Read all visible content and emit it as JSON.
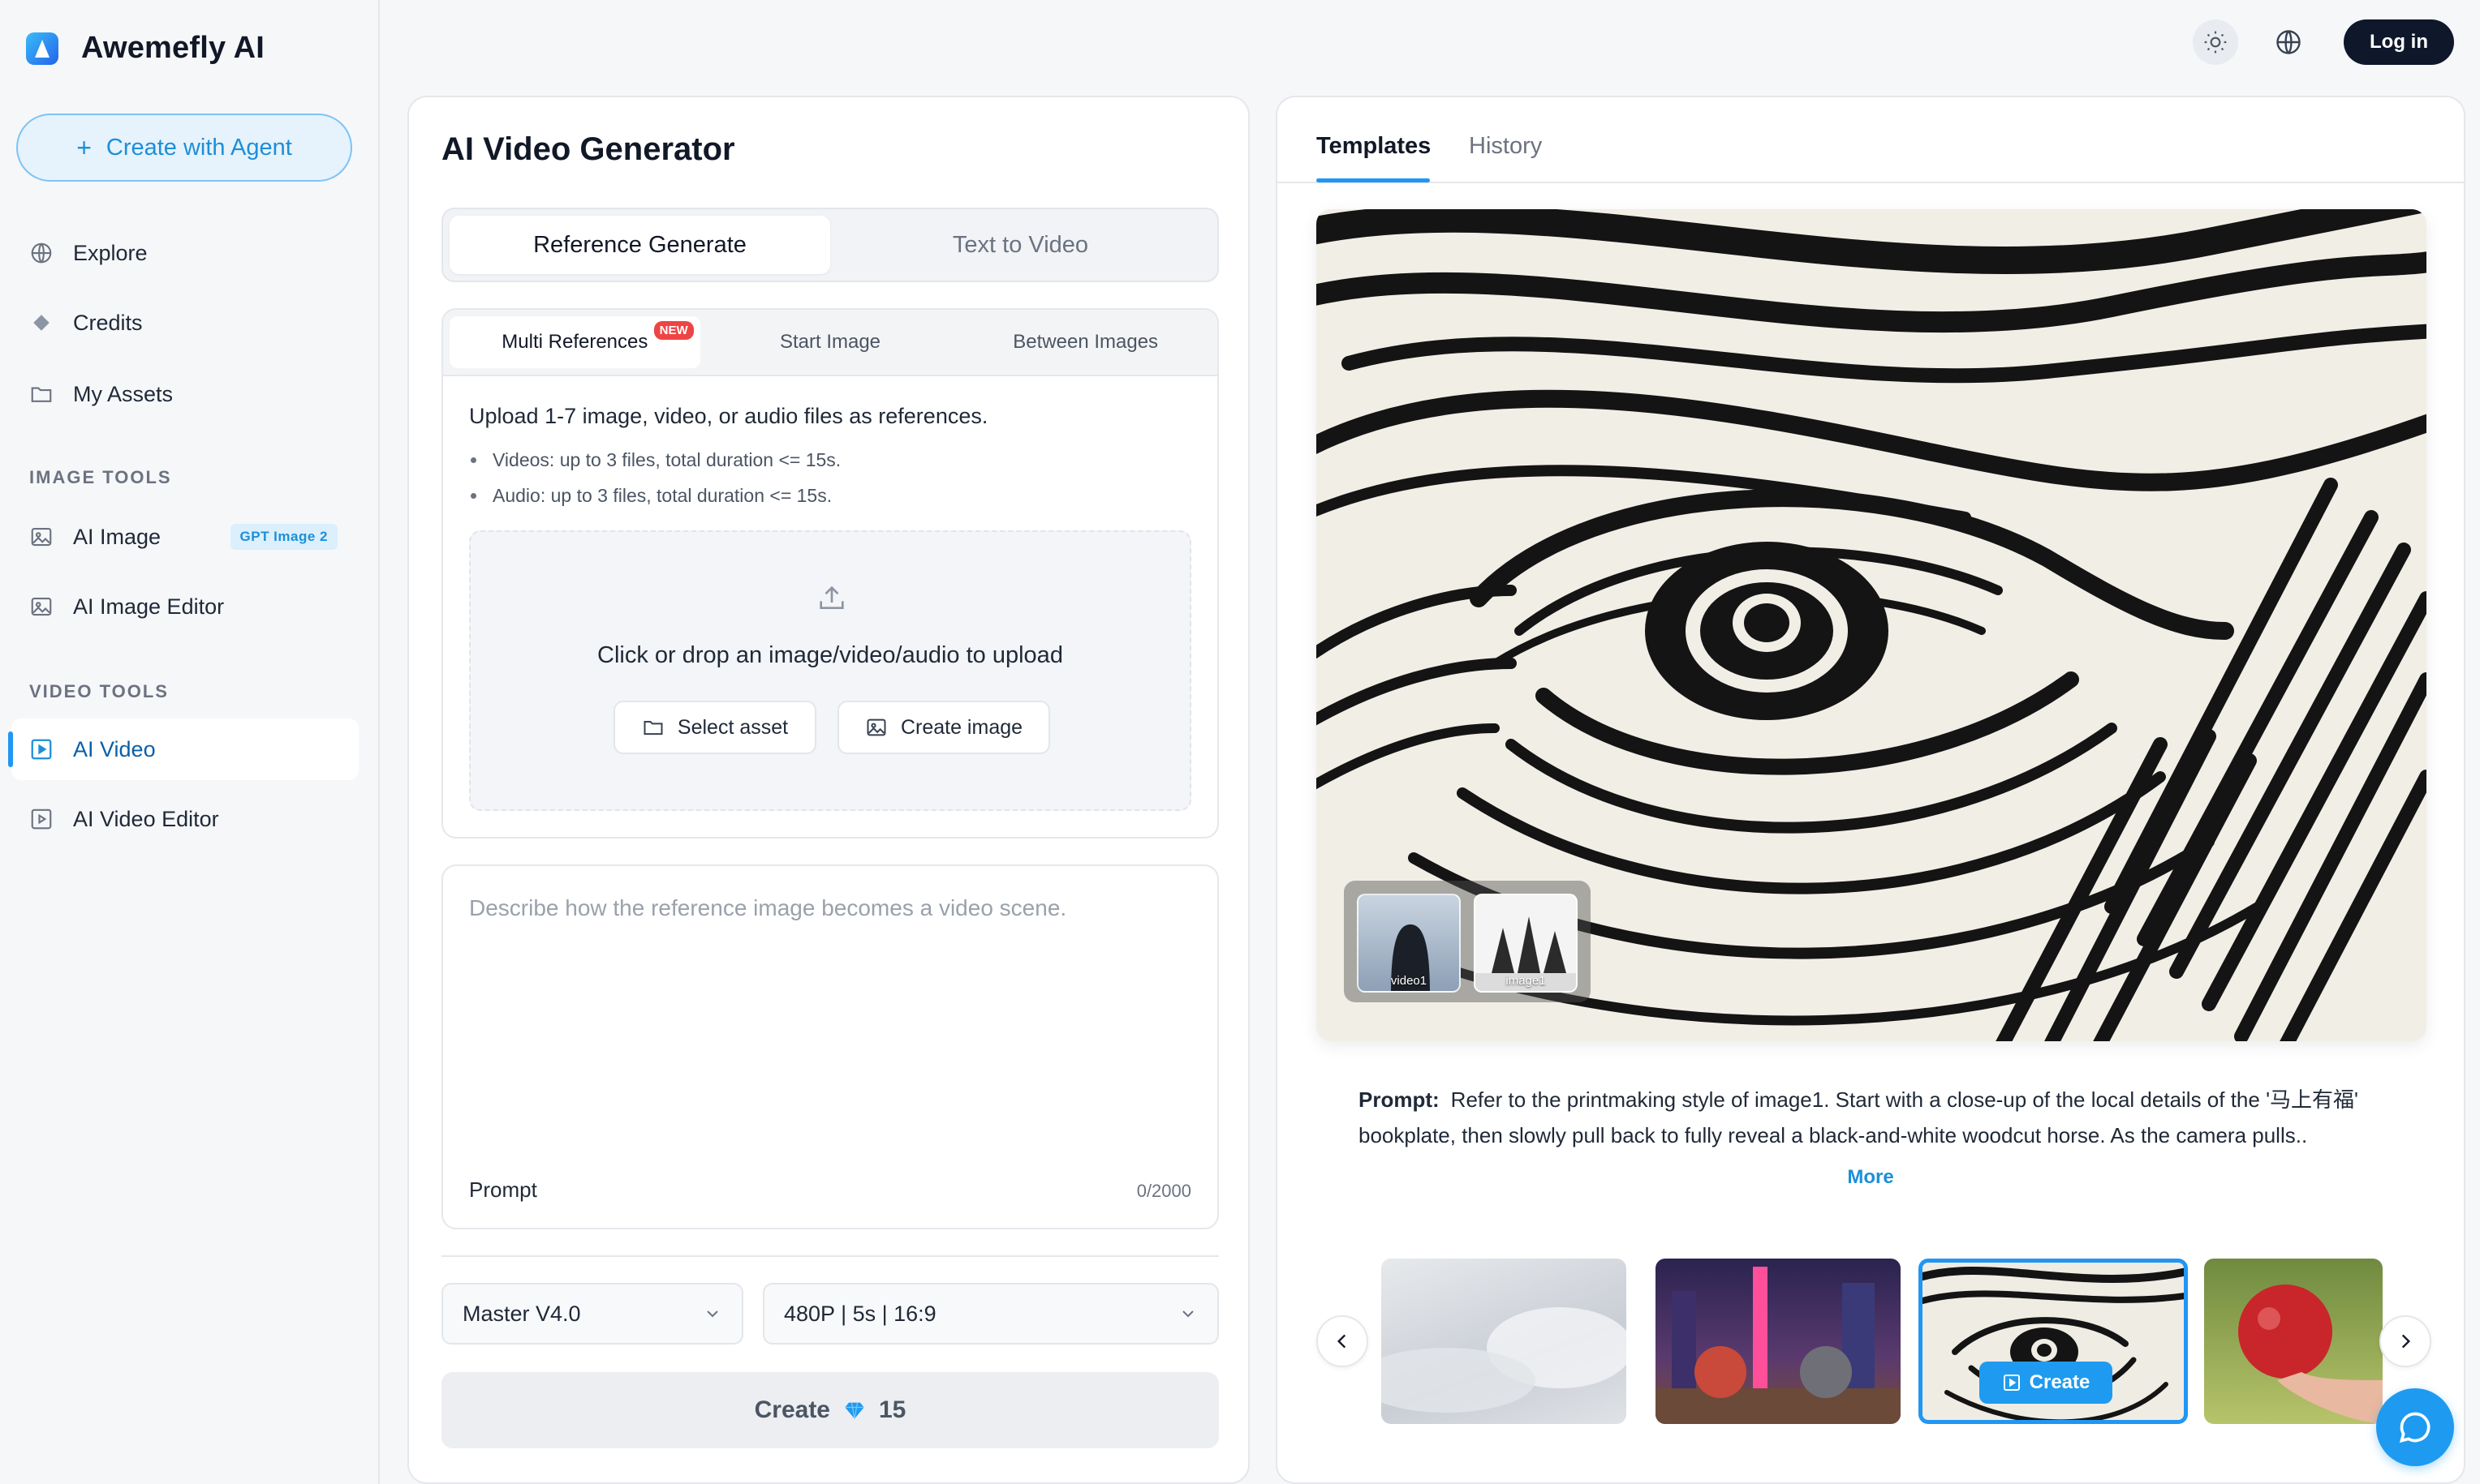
{
  "brand": {
    "name": "Awemefly AI"
  },
  "sidebar": {
    "agent_button": "Create with Agent",
    "main_items": [
      {
        "label": "Explore",
        "icon": "globe-icon"
      },
      {
        "label": "Credits",
        "icon": "diamond-icon"
      },
      {
        "label": "My Assets",
        "icon": "folder-icon"
      }
    ],
    "image_tools_label": "IMAGE TOOLS",
    "image_tools": [
      {
        "label": "AI Image",
        "icon": "image-icon",
        "badge": "GPT Image 2"
      },
      {
        "label": "AI Image Editor",
        "icon": "image-edit-icon"
      }
    ],
    "video_tools_label": "VIDEO TOOLS",
    "video_tools": [
      {
        "label": "AI Video",
        "icon": "video-icon",
        "active": true
      },
      {
        "label": "AI Video Editor",
        "icon": "video-edit-icon"
      }
    ]
  },
  "topbar": {
    "login": "Log in"
  },
  "generator": {
    "title": "AI Video Generator",
    "mode_tabs": [
      "Reference Generate",
      "Text to Video"
    ],
    "ref_tabs": [
      "Multi References",
      "Start Image",
      "Between Images"
    ],
    "new_badge": "NEW",
    "ref_description": "Upload 1-7 image, video, or audio files as references.",
    "ref_limits": [
      "Videos: up to 3 files, total duration <= 15s.",
      "Audio: up to 3 files, total duration <= 15s."
    ],
    "drop_text": "Click or drop an image/video/audio to upload",
    "select_asset": "Select asset",
    "create_image": "Create image",
    "prompt_placeholder": "Describe how the reference image becomes a video scene.",
    "prompt_label": "Prompt",
    "prompt_count": "0/2000",
    "model": "Master V4.0",
    "settings": "480P | 5s | 16:9",
    "create_label": "Create",
    "create_cost": "15"
  },
  "templates": {
    "tabs": [
      "Templates",
      "History"
    ],
    "ref_labels": [
      "video1",
      "image1"
    ],
    "prompt_label": "Prompt:",
    "prompt_text": "Refer to the printmaking style of image1. Start with a close-up of the local details of the '马上有福' bookplate, then slowly pull back to fully reveal a black-and-white woodcut horse. As the camera pulls..",
    "more": "More",
    "thumb_create": "Create"
  },
  "colors": {
    "accent": "#1e9bf0",
    "dark": "#0f172a",
    "active_nav": "#0b5fa8"
  }
}
